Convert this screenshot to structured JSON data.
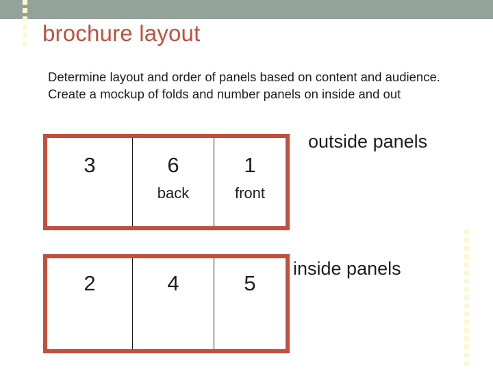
{
  "slide": {
    "title": "brochure layout",
    "body_text": "Determine layout and order of panels based on content and audience. Create a mockup of folds and number panels on inside and out",
    "theme": {
      "bar_color": "#93a399",
      "accent_color": "#c0503c",
      "dot_color": "#fbf8d0",
      "text_color": "#1d1d1d"
    }
  },
  "decorations": {
    "left_dots_count": 6,
    "right_dots_count": 17
  },
  "diagram": {
    "outside": {
      "caption": "outside panels",
      "cells": [
        {
          "number": "3",
          "label": ""
        },
        {
          "number": "6",
          "label": "back"
        },
        {
          "number": "1",
          "label": "front"
        }
      ]
    },
    "inside": {
      "caption": "inside panels",
      "cells": [
        {
          "number": "2",
          "label": ""
        },
        {
          "number": "4",
          "label": ""
        },
        {
          "number": "5",
          "label": ""
        }
      ]
    }
  }
}
